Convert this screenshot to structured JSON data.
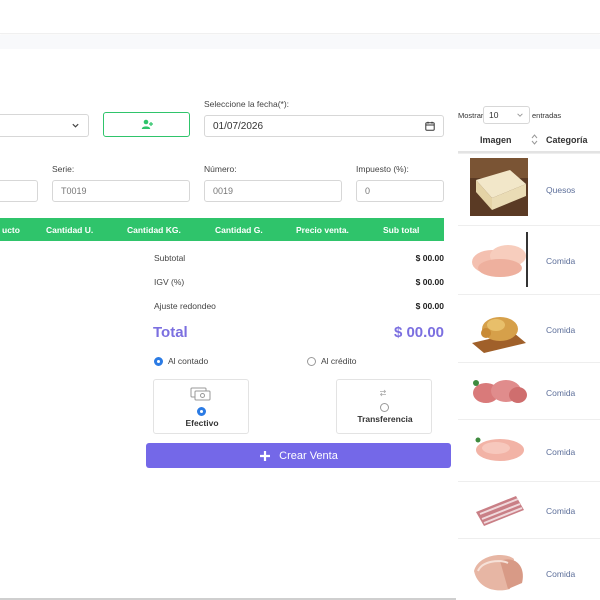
{
  "form": {
    "fecha_label": "Seleccione la fecha(*):",
    "fecha_value": "01/07/2026",
    "serie_label": "Serie:",
    "serie_placeholder": "T0019",
    "numero_label": "Número:",
    "numero_placeholder": "0019",
    "impuesto_label": "Impuesto (%):",
    "impuesto_placeholder": "0"
  },
  "table": {
    "headers": [
      "ucto",
      "Cantidad U.",
      "Cantidad KG.",
      "Cantidad G.",
      "Precio venta.",
      "Sub total"
    ]
  },
  "summary": {
    "subtotal_label": "Subtotal",
    "subtotal_value": "$ 00.00",
    "igv_label": "IGV (%)",
    "igv_value": "$ 00.00",
    "ajuste_label": "Ajuste redondeo",
    "ajuste_value": "$ 00.00",
    "total_label": "Total",
    "total_value": "$ 00.00"
  },
  "payment": {
    "contado_label": "Al contado",
    "credito_label": "Al crédito",
    "efectivo_label": "Efectivo",
    "transferencia_label": "Transferencia",
    "crear_label": "Crear Venta"
  },
  "products": {
    "mostrar_label": "Mostrar",
    "mostrar_value": "10",
    "entradas_label": "entradas",
    "col_imagen": "Imagen",
    "col_categoria": "Categoría",
    "rows": [
      {
        "categoria": "Quesos",
        "icon": "cheese-image"
      },
      {
        "categoria": "Comida",
        "icon": "chicken-breast-image"
      },
      {
        "categoria": "Comida",
        "icon": "roast-chicken-image"
      },
      {
        "categoria": "Comida",
        "icon": "ground-meat-image"
      },
      {
        "categoria": "Comida",
        "icon": "fillet-image"
      },
      {
        "categoria": "Comida",
        "icon": "ribs-image"
      },
      {
        "categoria": "Comida",
        "icon": "pork-image"
      }
    ]
  },
  "colors": {
    "accent_green": "#2fc46b",
    "accent_purple": "#7468e8",
    "total_purple": "#7b6fe0",
    "radio_blue": "#2b7be4"
  }
}
